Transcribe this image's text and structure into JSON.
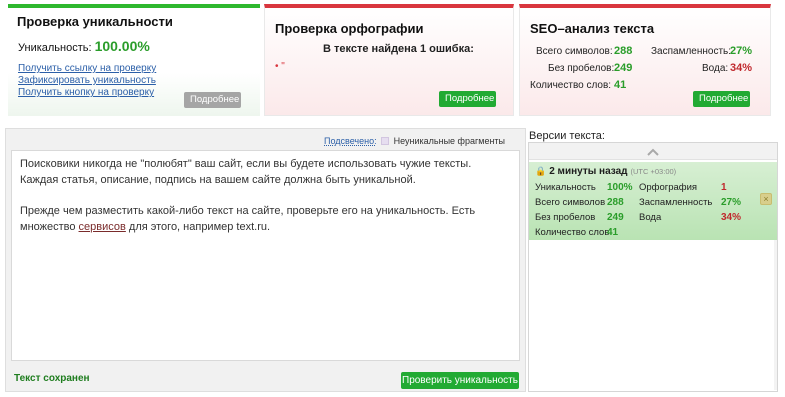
{
  "uniqueness": {
    "title": "Проверка уникальности",
    "label": "Уникальность:",
    "value": "100.00%",
    "links": [
      "Получить ссылку на проверку",
      "Зафиксировать уникальность",
      "Получить кнопку на проверку"
    ],
    "more_label": "Подробнее"
  },
  "spelling": {
    "title": "Проверка орфографии",
    "errors_text": "В тексте найдена 1 ошибка:",
    "error_marker": "• \"",
    "more_label": "Подробнее"
  },
  "seo": {
    "title": "SEO–анализ текста",
    "total_label": "Всего символов:",
    "total_value": "288",
    "nospace_label": "Без пробелов:",
    "nospace_value": "249",
    "words_label": "Количество слов:",
    "words_value": "41",
    "spam_label": "Заспамленность:",
    "spam_value": "27%",
    "water_label": "Вода:",
    "water_value": "34%",
    "more_label": "Подробнее"
  },
  "editor": {
    "legend_highlighted": "Подсвечено:",
    "legend_item": "Неуникальные фрагменты",
    "paragraph1": "Поисковики никогда не \"полюбят\" ваш сайт, если вы будете использовать чужие тексты. Каждая статья, описание, подпись на вашем сайте должна быть уникальной.",
    "paragraph2_pre": "Прежде чем разместить какой-либо текст на сайте, проверьте его на уникальность. Есть множество ",
    "paragraph2_link": "сервисов",
    "paragraph2_post": " для этого, например text.ru.",
    "saved_status": "Текст сохранен",
    "check_button": "Проверить уникальность"
  },
  "versions": {
    "title": "Версии текста:",
    "scroll_up_icon": "chevron-up-icon",
    "card": {
      "time": "2 минуты назад",
      "utc": "(UTC +03:00)",
      "uniq_label": "Уникальность",
      "uniq_value": "100%",
      "total_label": "Всего символов",
      "total_value": "288",
      "nospace_label": "Без пробелов",
      "nospace_value": "249",
      "words_label": "Количество слов",
      "words_value": "41",
      "spell_label": "Орфография",
      "spell_value": "1",
      "spam_label": "Заспамленность",
      "spam_value": "27%",
      "water_label": "Вода",
      "water_value": "34%"
    }
  },
  "colors": {
    "green": "#22aa33",
    "red": "#d9363e",
    "link": "#2b5fa8"
  }
}
